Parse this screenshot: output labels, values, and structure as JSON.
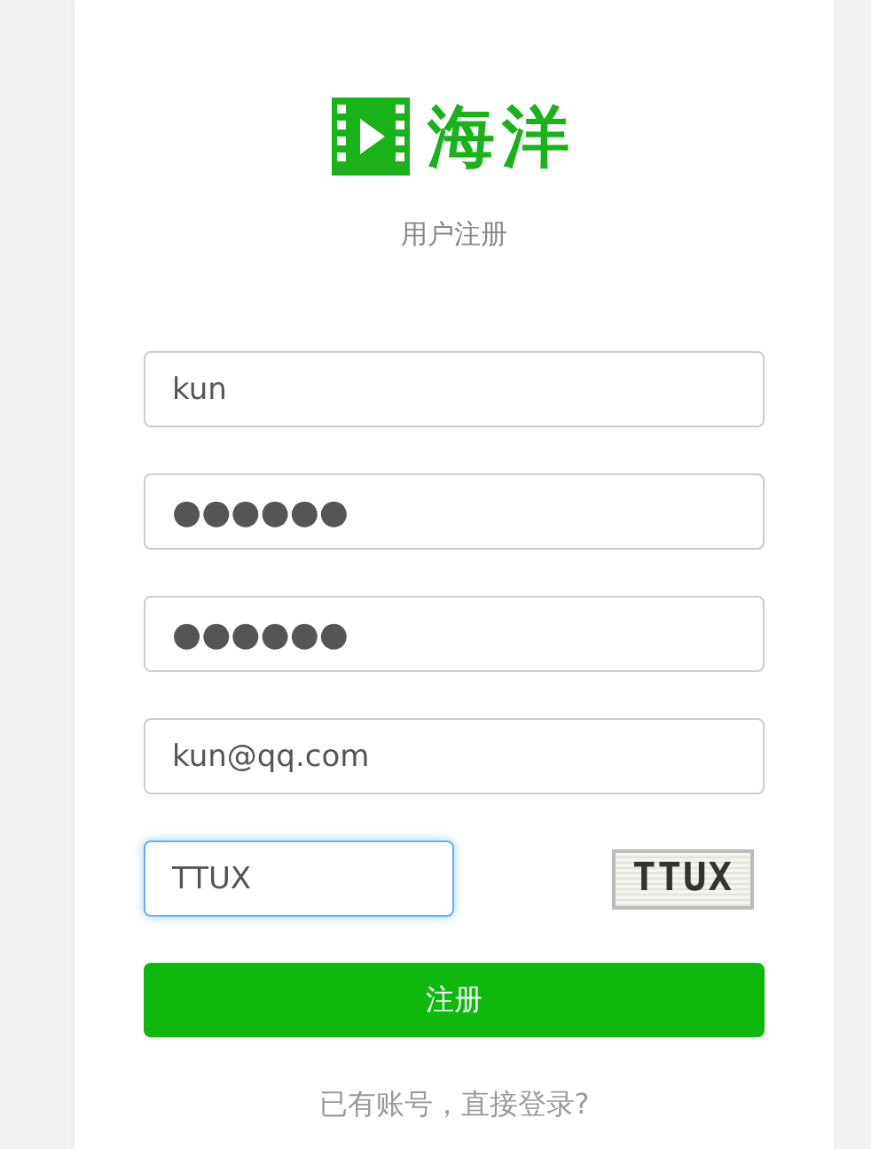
{
  "logo": {
    "text": "海洋"
  },
  "subtitle": "用户注册",
  "fields": [
    {
      "kind": "text",
      "value": "kun",
      "focused": false
    },
    {
      "kind": "password",
      "value": "●●●●●●",
      "focused": false
    },
    {
      "kind": "password",
      "value": "●●●●●●",
      "focused": false
    },
    {
      "kind": "text",
      "value": "kun@qq.com",
      "focused": false
    },
    {
      "kind": "captcha",
      "value": "TTUX",
      "focused": true,
      "captcha_image": "TTUX"
    }
  ],
  "submit": "注册",
  "login_link": "已有账号，直接登录?"
}
